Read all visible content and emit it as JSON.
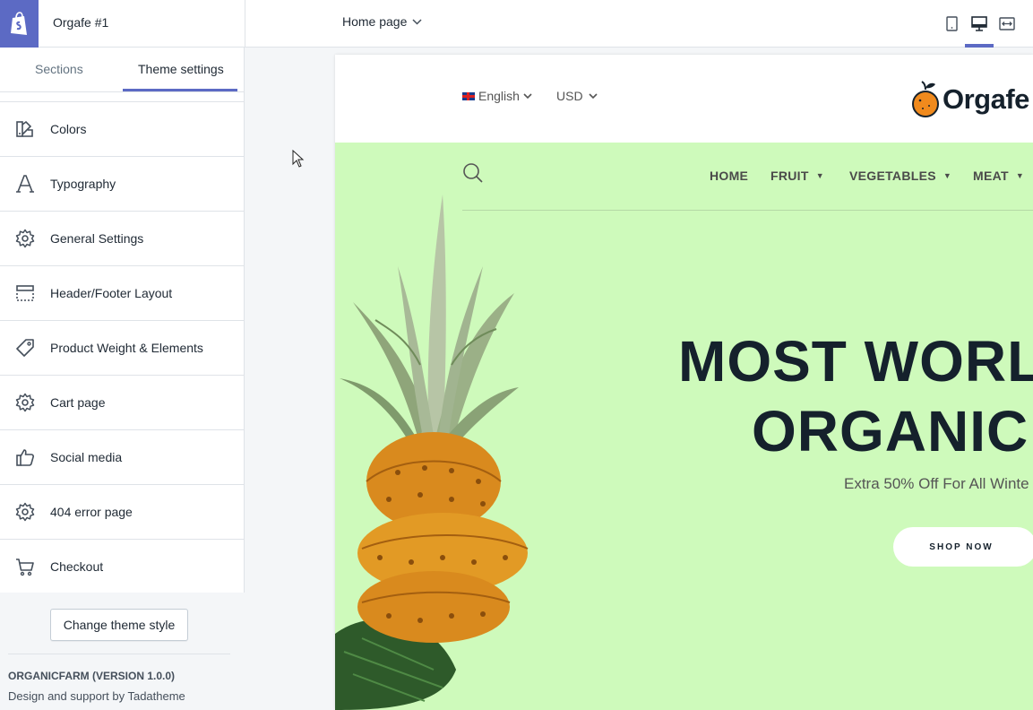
{
  "topbar": {
    "store_name": "Orgafe #1",
    "page_selector": "Home page",
    "view_modes": [
      "mobile-view-icon",
      "desktop-view-icon",
      "fullscreen-view-icon"
    ],
    "active_view": "desktop",
    "accent_color": "#5c6ac4"
  },
  "sidebar": {
    "tabs": [
      {
        "label": "Sections"
      },
      {
        "label": "Theme settings"
      }
    ],
    "active_tab": "Theme settings",
    "items": [
      {
        "label": "Colors",
        "icon": "colors-icon"
      },
      {
        "label": "Typography",
        "icon": "typography-icon"
      },
      {
        "label": "General Settings",
        "icon": "gear-icon"
      },
      {
        "label": "Header/Footer Layout",
        "icon": "layout-icon"
      },
      {
        "label": "Product Weight & Elements",
        "icon": "tag-icon"
      },
      {
        "label": "Cart page",
        "icon": "gear-icon"
      },
      {
        "label": "Social media",
        "icon": "thumbs-up-icon"
      },
      {
        "label": "404 error page",
        "icon": "gear-icon"
      },
      {
        "label": "Checkout",
        "icon": "cart-icon"
      }
    ],
    "change_theme_label": "Change theme style",
    "version": "ORGANICFARM (VERSION 1.0.0)",
    "support": "Design and support by Tadatheme"
  },
  "preview": {
    "language": "English",
    "currency": "USD",
    "brand": "Orgafe",
    "nav": [
      "HOME",
      "FRUIT",
      "VEGETABLES",
      "MEAT"
    ],
    "headline_line1": "MOST WORLD",
    "headline_line2": "ORGANIC",
    "subheadline": "Extra 50% Off For All Winte",
    "cta": "SHOP NOW",
    "hero_bg": "#cefabb"
  }
}
